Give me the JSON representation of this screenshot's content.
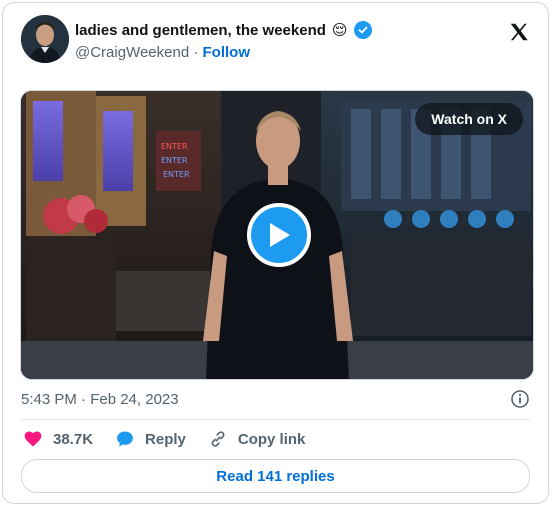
{
  "tweet": {
    "display_name": "ladies and gentlemen, the weekend",
    "emoji": "😌",
    "handle": "@CraigWeekend",
    "separator": "·",
    "follow_label": "Follow",
    "timestamp": "5:43 PM · Feb 24, 2023"
  },
  "media": {
    "watch_label": "Watch on X"
  },
  "actions": {
    "like_count": "38.7K",
    "reply_label": "Reply",
    "copy_link_label": "Copy link"
  },
  "footer": {
    "read_replies_label": "Read 141 replies"
  },
  "colors": {
    "brand_blue": "#1d9bf0",
    "link_blue": "#006fd6",
    "like_pink": "#f91880",
    "muted_text": "#536471"
  }
}
